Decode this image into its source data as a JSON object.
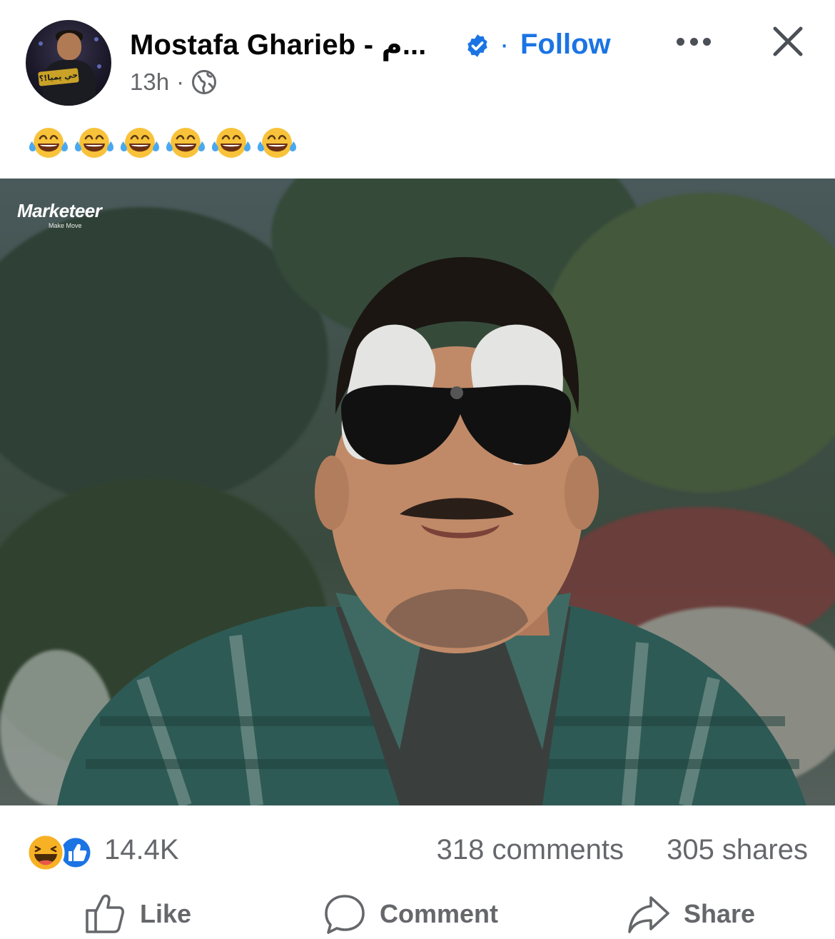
{
  "post": {
    "author": "Mostafa Gharieb - م...",
    "separator": "·",
    "follow_label": "Follow",
    "timestamp": "13h",
    "timestamp_sep": "·",
    "privacy_icon": "globe-icon",
    "more_icon": "more-horizontal-icon",
    "close_icon": "close-icon",
    "verified_icon": "verified-badge-icon",
    "caption_emojis": [
      "😂",
      "😂",
      "😂",
      "😂",
      "😂",
      "😂"
    ],
    "avatar_sign_text": "حي يميا!؟"
  },
  "media": {
    "watermark_brand": "Marketeer",
    "watermark_tagline": "Make Move"
  },
  "stats": {
    "reaction_icons": [
      "haha-reaction-icon",
      "like-reaction-icon"
    ],
    "reactions_count": "14.4K",
    "comments": "318 comments",
    "shares": "305 shares"
  },
  "actions": {
    "like": "Like",
    "comment": "Comment",
    "share": "Share"
  },
  "colors": {
    "accent": "#1b74e4",
    "secondary_text": "#65676b",
    "primary_text": "#050505"
  }
}
